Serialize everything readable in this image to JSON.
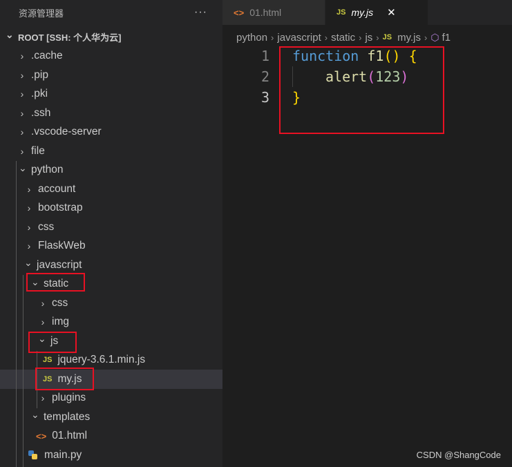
{
  "sidebar": {
    "title": "资源管理器",
    "more": "···",
    "root": "ROOT [SSH: 个人华为云]",
    "items": [
      {
        "label": ".cache"
      },
      {
        "label": ".pip"
      },
      {
        "label": ".pki"
      },
      {
        "label": ".ssh"
      },
      {
        "label": ".vscode-server"
      },
      {
        "label": "file"
      },
      {
        "label": "python"
      },
      {
        "label": "account"
      },
      {
        "label": "bootstrap"
      },
      {
        "label": "css"
      },
      {
        "label": "FlaskWeb"
      },
      {
        "label": "javascript"
      },
      {
        "label": "static"
      },
      {
        "label": "css"
      },
      {
        "label": "img"
      },
      {
        "label": "js"
      },
      {
        "label": "jquery-3.6.1.min.js"
      },
      {
        "label": "my.js"
      },
      {
        "label": "plugins"
      },
      {
        "label": "templates"
      },
      {
        "label": "01.html"
      },
      {
        "label": "main.py"
      }
    ]
  },
  "tabs": [
    {
      "label": "01.html",
      "icon": "<>"
    },
    {
      "label": "my.js",
      "icon": "JS",
      "close": "✕"
    }
  ],
  "breadcrumb": {
    "items": [
      "python",
      "javascript",
      "static",
      "js",
      "my.js",
      "f1"
    ],
    "file_icon": "JS"
  },
  "editor": {
    "line_numbers": [
      "1",
      "2",
      "3"
    ],
    "line1": {
      "kw": "function",
      "name": "f1",
      "parens": "()",
      "brace": "{"
    },
    "line2": {
      "call": "alert",
      "open": "(",
      "arg": "123",
      "close": ")"
    },
    "line3": {
      "brace": "}"
    }
  },
  "icons": {
    "js": "JS",
    "html": "<>",
    "python": "python-file-icon"
  },
  "colors": {
    "highlight_box": "#e81123",
    "selected_row": "#37373d"
  },
  "watermark": "CSDN @ShangCode"
}
